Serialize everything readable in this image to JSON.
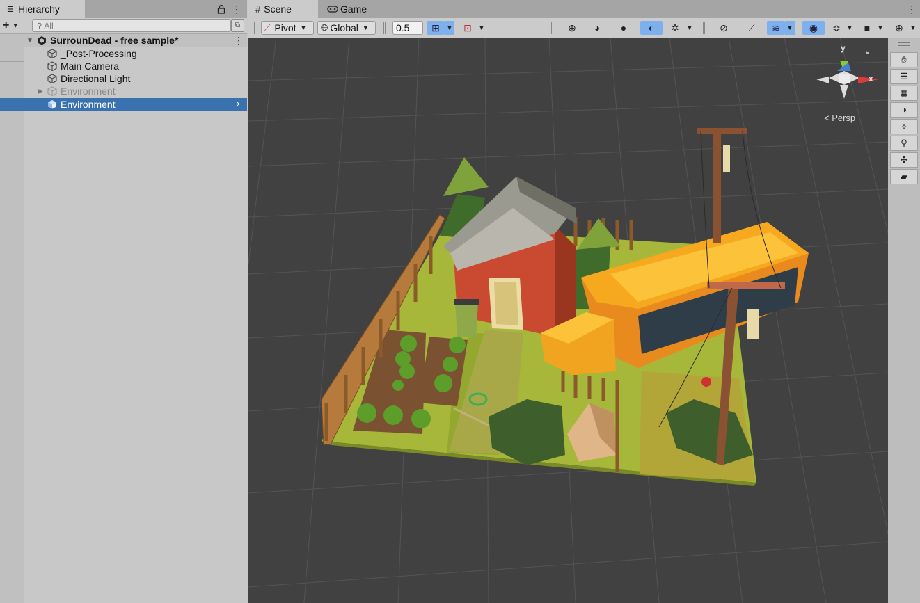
{
  "hierarchy": {
    "tab_title": "Hierarchy",
    "add_label": "+",
    "search_placeholder": "All",
    "scene_name": "SurrounDead - free sample*",
    "items": [
      {
        "label": "_Post-Processing",
        "state": "normal"
      },
      {
        "label": "Main Camera",
        "state": "normal"
      },
      {
        "label": "Directional Light",
        "state": "normal"
      },
      {
        "label": "Environment",
        "state": "disabled"
      },
      {
        "label": "Environment",
        "state": "selected"
      }
    ]
  },
  "scene_view": {
    "tabs": [
      {
        "label": "Scene",
        "icon": "grid-icon",
        "active": true
      },
      {
        "label": "Game",
        "icon": "gamepad-icon",
        "active": false
      }
    ],
    "toolbar": {
      "pivot_label": "Pivot",
      "global_label": "Global",
      "snap_value": "0.5"
    },
    "gizmo": {
      "y_label": "y",
      "x_label": "x",
      "projection_label": "< Persp"
    },
    "colors": {
      "selection": "#3a72b0",
      "toggle_on": "#7fb0ee",
      "viewport": "#414141"
    }
  }
}
